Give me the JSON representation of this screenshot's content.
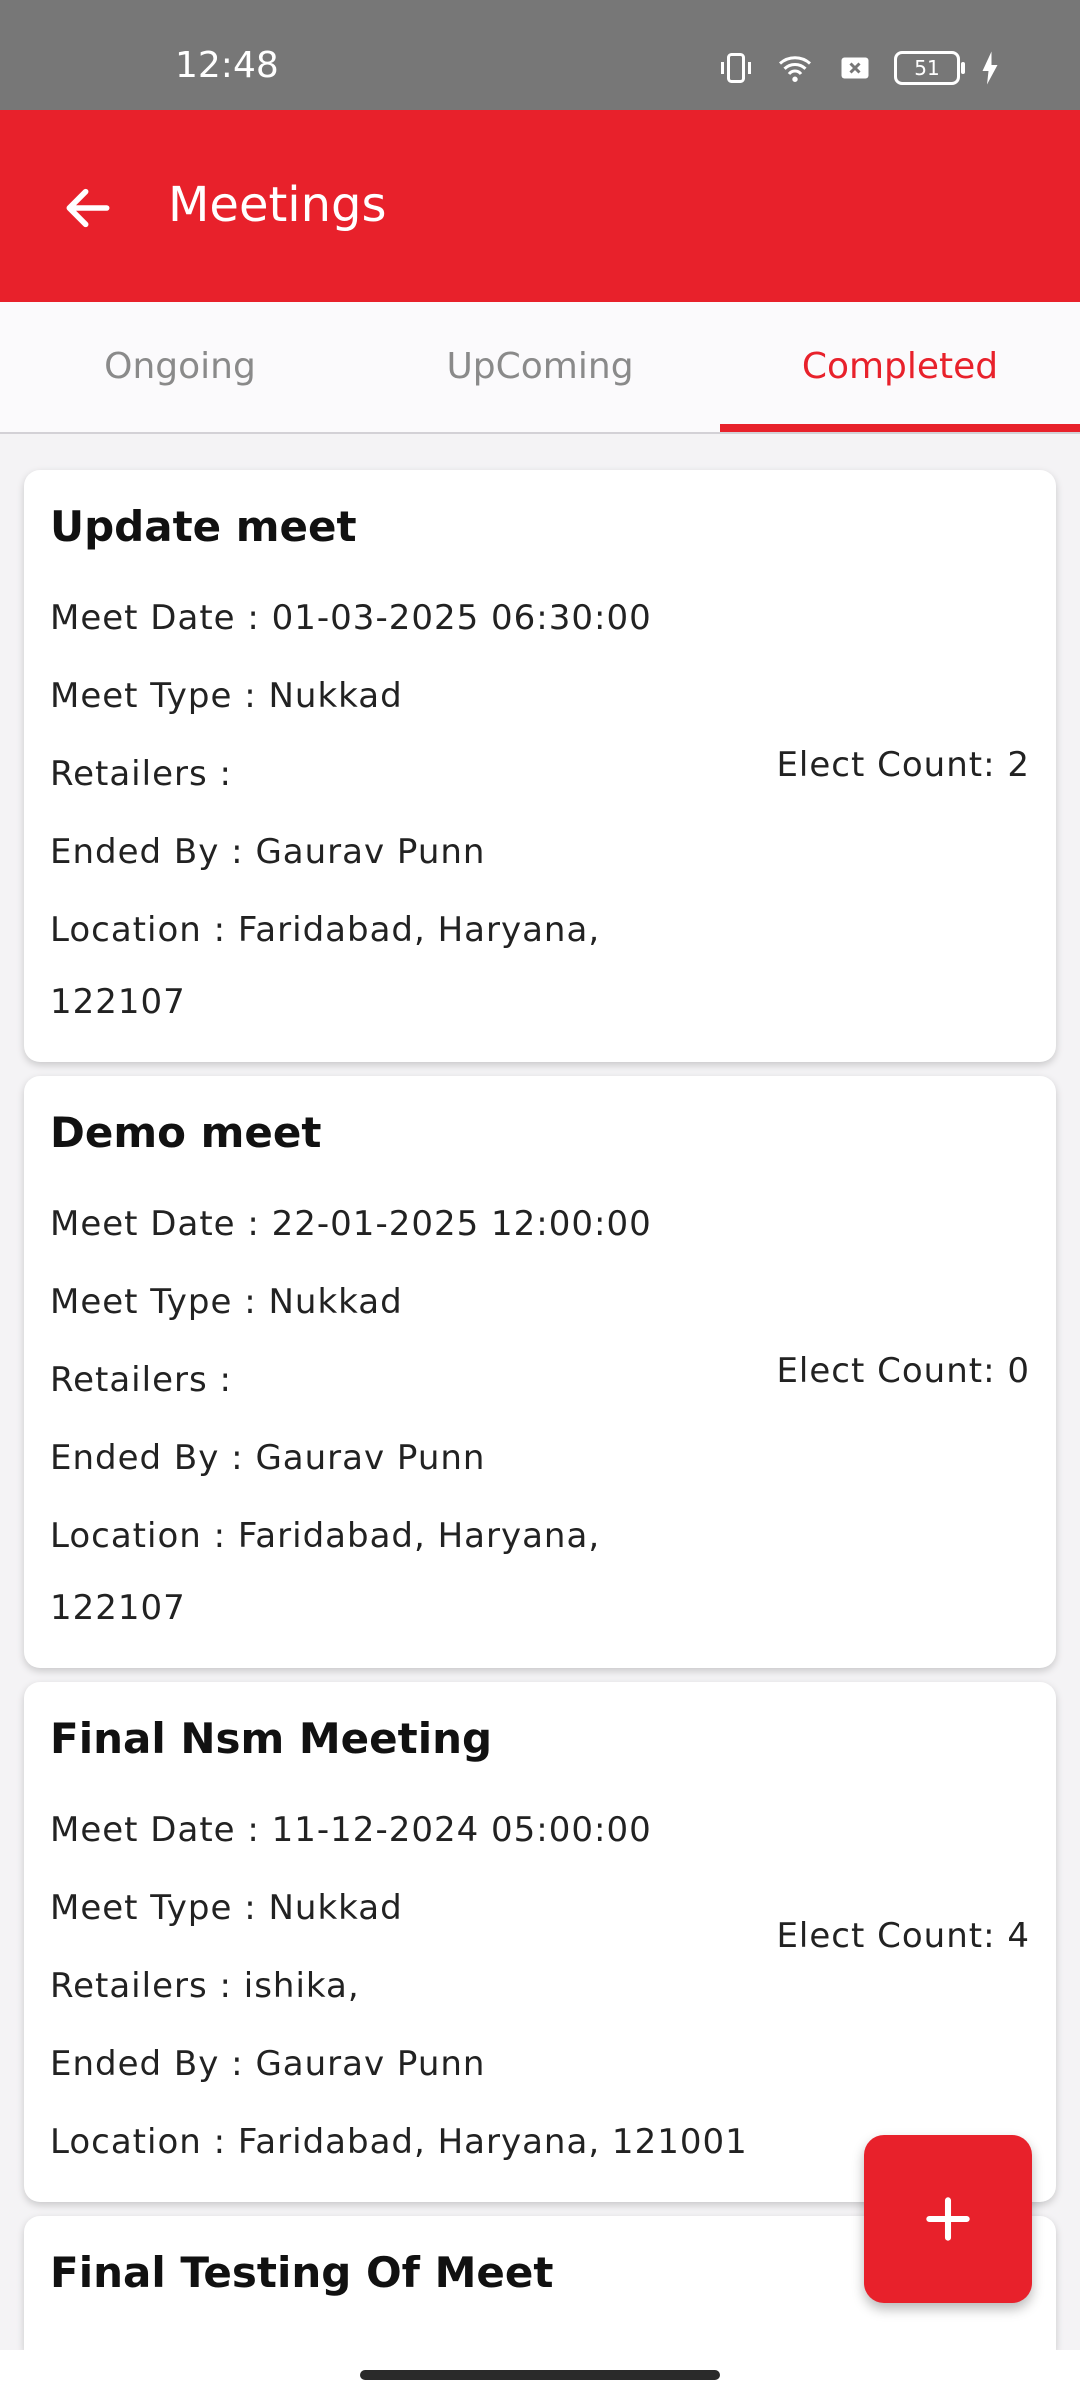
{
  "status": {
    "time": "12:48",
    "battery": "51"
  },
  "appbar": {
    "title": "Meetings"
  },
  "tabs": [
    {
      "label": "Ongoing"
    },
    {
      "label": "UpComing"
    },
    {
      "label": "Completed"
    }
  ],
  "meetings": [
    {
      "title": "Update meet",
      "date": "Meet Date : 01-03-2025 06:30:00",
      "type": "Meet Type : Nukkad",
      "retailers": "Retailers :",
      "ended_by": "Ended By : Gaurav Punn",
      "location_line1": "Location : Faridabad, Haryana,",
      "location_line2": "122107",
      "elect_count": "Elect Count: 2"
    },
    {
      "title": "Demo meet",
      "date": "Meet Date : 22-01-2025 12:00:00",
      "type": "Meet Type : Nukkad",
      "retailers": "Retailers :",
      "ended_by": "Ended By : Gaurav Punn",
      "location_line1": "Location : Faridabad, Haryana,",
      "location_line2": "122107",
      "elect_count": "Elect Count: 0"
    },
    {
      "title": "Final Nsm Meeting",
      "date": "Meet Date : 11-12-2024 05:00:00",
      "type": "Meet Type : Nukkad",
      "retailers": "Retailers : ishika,",
      "ended_by": "Ended By : Gaurav Punn",
      "location_line1": "Location : Faridabad, Haryana, 121001",
      "elect_count": "Elect Count: 4"
    },
    {
      "title": "Final Testing Of Meet"
    }
  ],
  "colors": {
    "accent": "#e8212b"
  }
}
